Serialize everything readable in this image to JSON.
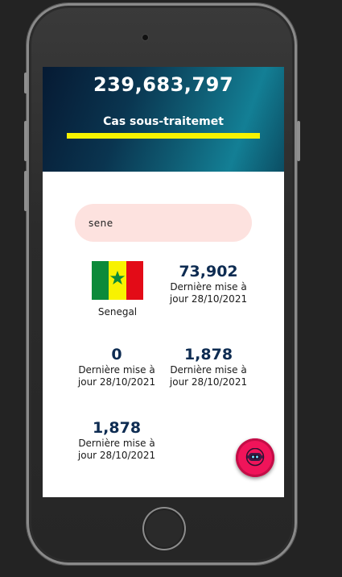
{
  "hero": {
    "total_count": "239,683,797",
    "label": "Cas sous-traitemet"
  },
  "search": {
    "value": "sene",
    "placeholder": ""
  },
  "country": {
    "name": "Senegal",
    "flag_icon": "senegal-flag-icon"
  },
  "stats": [
    {
      "value": "73,902",
      "updated_line1": "Dernière mise à",
      "updated_line2": "jour 28/10/2021"
    },
    {
      "value": "0",
      "updated_line1": "Dernière mise à",
      "updated_line2": "jour 28/10/2021"
    },
    {
      "value": "1,878",
      "updated_line1": "Dernière mise à",
      "updated_line2": "jour 28/10/2021"
    },
    {
      "value": "1,878",
      "updated_line1": "Dernière mise à",
      "updated_line2": "jour 28/10/2021"
    }
  ],
  "fab": {
    "icon": "robot-chat-icon"
  },
  "colors": {
    "accent_bar": "#f7f300",
    "stat_number": "#0e2c52",
    "search_bg": "#fde2df",
    "fab": "#f0145a"
  }
}
